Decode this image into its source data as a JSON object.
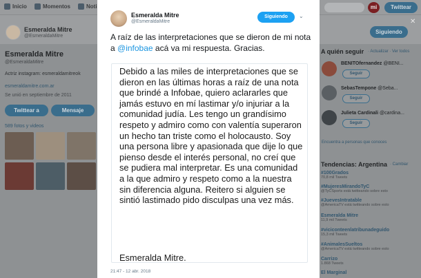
{
  "topnav": {
    "items": [
      {
        "label": "Inicio",
        "icon": "home-icon"
      },
      {
        "label": "Momentos",
        "icon": "lightning-icon"
      },
      {
        "label": "Noti",
        "icon": "bell-icon"
      }
    ],
    "logo": "mi",
    "tweet_button": "Twittear"
  },
  "profile": {
    "name": "Esmeralda Mitre",
    "handle": "@EsmeraldaMitre",
    "bio": "Actriz instagram: esmeraldamitreok",
    "url": "esmeraldamitre.com.ar",
    "joined": "Se unió en septiembre de 2011",
    "tweet_button": "Twittear a",
    "message_button": "Mensaje",
    "photos_link": "589 fotos y videos",
    "follow_button": "Siguiendo"
  },
  "who_to_follow": {
    "title": "A quién seguir",
    "links": "· Actualizar · Ver todos",
    "users": [
      {
        "name": "BENITOfernandez",
        "handle": "@BENI...",
        "button": "Seguir"
      },
      {
        "name": "SebasTempone",
        "handle": "@Seba...",
        "button": "Seguir"
      },
      {
        "name": "Julieta Cardinali",
        "handle": "@cardina...",
        "button": "Seguir"
      }
    ],
    "find_link": "Encuentra a personas que conoces"
  },
  "trends": {
    "title": "Tendencias: Argentina",
    "change": "· Cambiar",
    "items": [
      {
        "name": "#100Grados",
        "meta": "70,8 mil Tweets"
      },
      {
        "name": "#MujeresMirandoTyC",
        "meta": "@TyCSports está twitteando sobre esto"
      },
      {
        "name": "#JuevesIntratable",
        "meta": "@AmericaTV está twitteando sobre esto"
      },
      {
        "name": "Esmeralda Mitre",
        "meta": "11,9 mil Tweets"
      },
      {
        "name": "#viciconteenlatribunadeguido",
        "meta": "15,3 mil Tweets"
      },
      {
        "name": "#AnimalesSueltos",
        "meta": "@AmericaTV está twitteando sobre esto"
      },
      {
        "name": "Carrizo",
        "meta": "1.868 Tweets"
      },
      {
        "name": "El Marginal",
        "meta": ""
      }
    ]
  },
  "tweet": {
    "author_name": "Esmeralda Mitre",
    "author_handle": "@EsmeraldaMitre",
    "follow_button": "Siguiendo",
    "text_before": "A raíz de las interpretaciones que se dieron de mi nota a ",
    "mention": "@infobae",
    "text_after": " acá va mi respuesta. Gracias.",
    "statement": "Debido a las miles de interpretaciones que se dieron en las últimas horas a raíz de una nota que brindé a Infobae, quiero aclararles que jamás estuvo en mí lastimar y/o injuriar a la comunidad judía. Les tengo un grandísimo respeto y admiro como con valentía superaron un hecho tan triste como el holocausto. Soy una persona libre y apasionada que dije lo que pienso desde el interés personal, no creí que se pudiera mal interpretar. Es una comunidad a la que admiro y respeto como a la nuestra sin diferencia alguna. Reitero si alguien se sintió lastimado pido disculpas una vez más.",
    "signature": "Esmeralda Mitre.",
    "timestamp": "21:47 - 12 abr. 2018"
  }
}
